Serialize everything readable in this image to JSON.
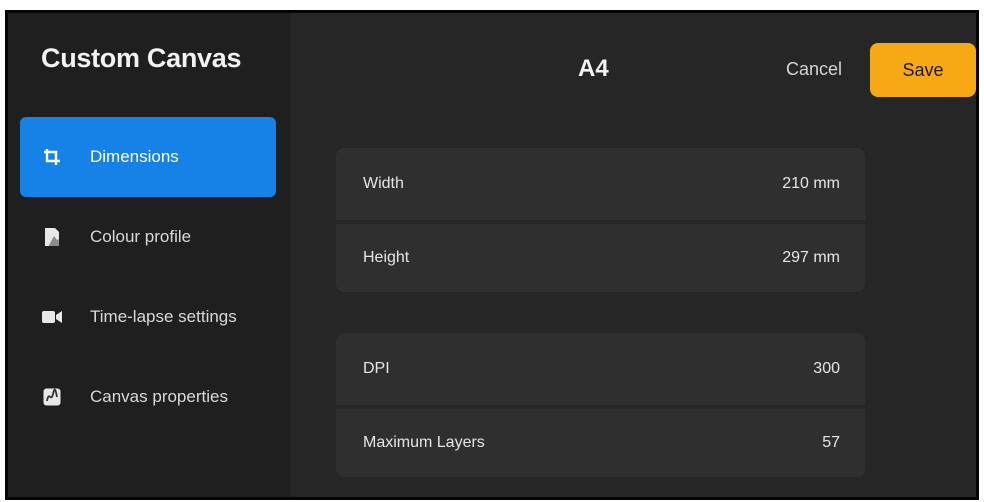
{
  "sidebar": {
    "title": "Custom Canvas",
    "items": [
      {
        "label": "Dimensions",
        "icon": "crop-icon",
        "active": true
      },
      {
        "label": "Colour profile",
        "icon": "colour-profile-icon",
        "active": false
      },
      {
        "label": "Time-lapse settings",
        "icon": "video-camera-icon",
        "active": false
      },
      {
        "label": "Canvas properties",
        "icon": "canvas-properties-icon",
        "active": false
      }
    ]
  },
  "header": {
    "title": "A4",
    "cancel_label": "Cancel",
    "save_label": "Save"
  },
  "dimensions": {
    "width": {
      "label": "Width",
      "value": "210 mm"
    },
    "height": {
      "label": "Height",
      "value": "297 mm"
    },
    "dpi": {
      "label": "DPI",
      "value": "300"
    },
    "max_layers": {
      "label": "Maximum Layers",
      "value": "57"
    }
  },
  "colors": {
    "accent": "#1682e8",
    "save": "#f6a915",
    "background": "#262626",
    "sidebar": "#1f1f1f",
    "row": "#2f2f2f"
  }
}
